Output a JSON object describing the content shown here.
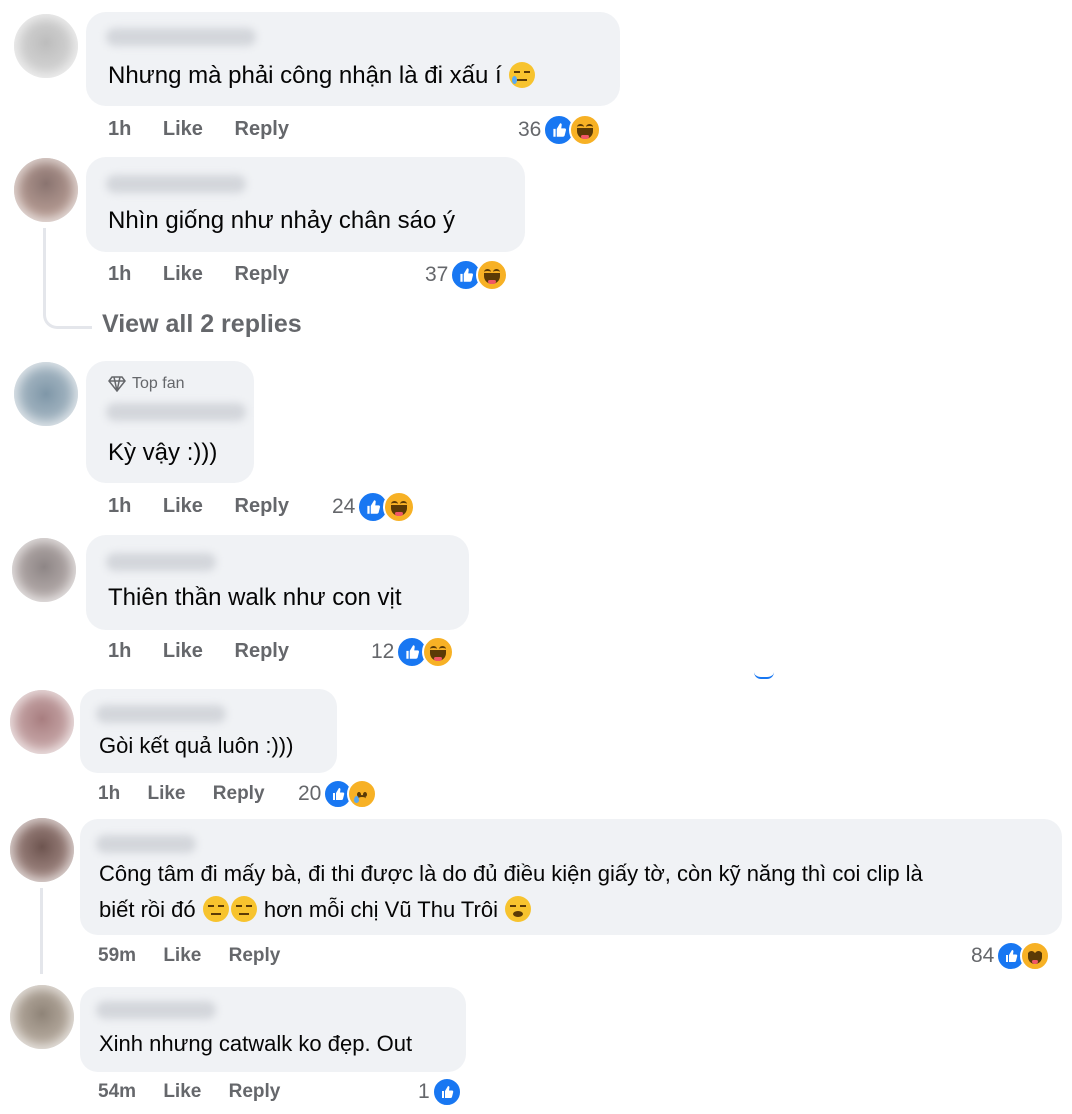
{
  "actions": {
    "like": "Like",
    "reply": "Reply"
  },
  "view_replies": "View all 2 replies",
  "top_fan_label": "Top fan",
  "colors": {
    "like_blue": "#1877f2",
    "bubble_bg": "#f0f2f5",
    "meta_gray": "#65676b",
    "haha_yellow": "#f7b125"
  },
  "comments": [
    {
      "text": "Nhưng mà phải công nhận là đi xấu í",
      "trailing_emoji": "crying-face",
      "time": "1h",
      "reaction_count": "36",
      "reactions": [
        "like",
        "haha"
      ]
    },
    {
      "text": "Nhìn giống như nhảy chân sáo ý",
      "time": "1h",
      "reaction_count": "37",
      "reactions": [
        "like",
        "haha"
      ]
    },
    {
      "text": "Kỳ vậy :)))",
      "badge": "Top fan",
      "time": "1h",
      "reaction_count": "24",
      "reactions": [
        "like",
        "haha"
      ]
    },
    {
      "text": "Thiên thần walk như con vịt",
      "time": "1h",
      "reaction_count": "12",
      "reactions": [
        "like",
        "haha"
      ]
    },
    {
      "text": "Gòi kết quả luôn :)))",
      "time": "1h",
      "reaction_count": "20",
      "reactions": [
        "like",
        "sad"
      ]
    },
    {
      "text_line1": "Công tâm đi mấy bà, đi thi được là do đủ điều kiện giấy tờ, còn kỹ năng thì coi clip là",
      "text_line2_a": "biết rồi đó",
      "text_line2_b": "hơn mỗi chị Vũ Thu Trôi",
      "inline_emojis": [
        "expressionless-face",
        "expressionless-face",
        "yawning-face"
      ],
      "time": "59m",
      "reaction_count": "84",
      "reactions": [
        "like",
        "haha"
      ]
    },
    {
      "text": "Xinh nhưng catwalk ko đẹp. Out",
      "time": "54m",
      "reaction_count": "1",
      "reactions": [
        "like"
      ]
    }
  ]
}
